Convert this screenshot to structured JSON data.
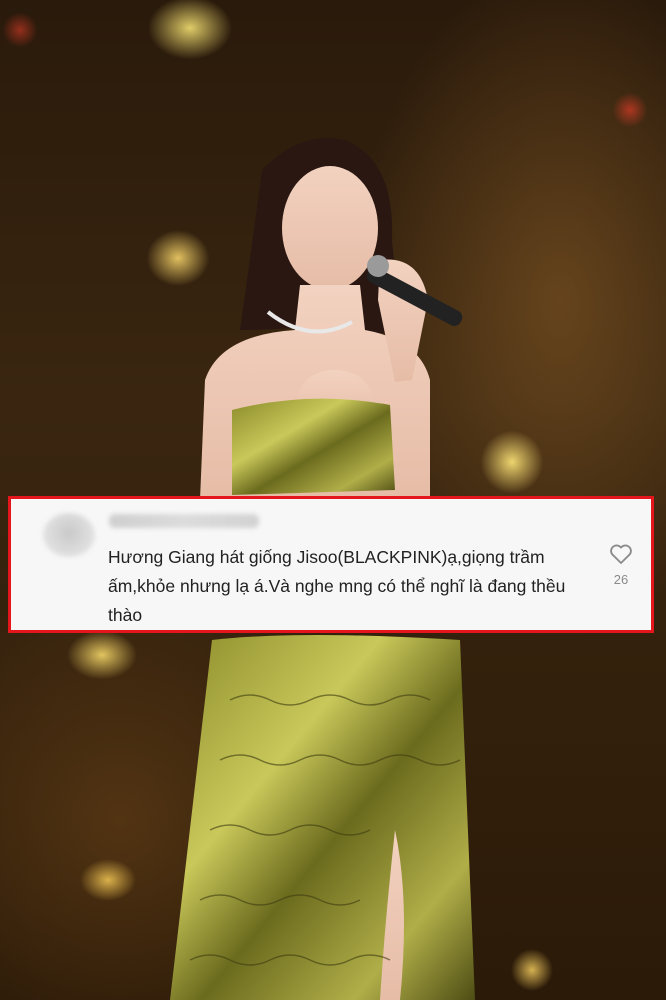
{
  "comment": {
    "text": "Hương Giang hát giống Jisoo(BLACKPINK)ạ,giọng trầm ấm,khỏe nhưng lạ á.Và nghe mng có thể nghĩ là đang thều thào",
    "like_count": "26",
    "like_icon": "heart-outline-icon"
  },
  "colors": {
    "highlight_border": "#e5151c",
    "card_background": "#f7f7f7",
    "text": "#222222",
    "muted": "#8a8a8a"
  }
}
